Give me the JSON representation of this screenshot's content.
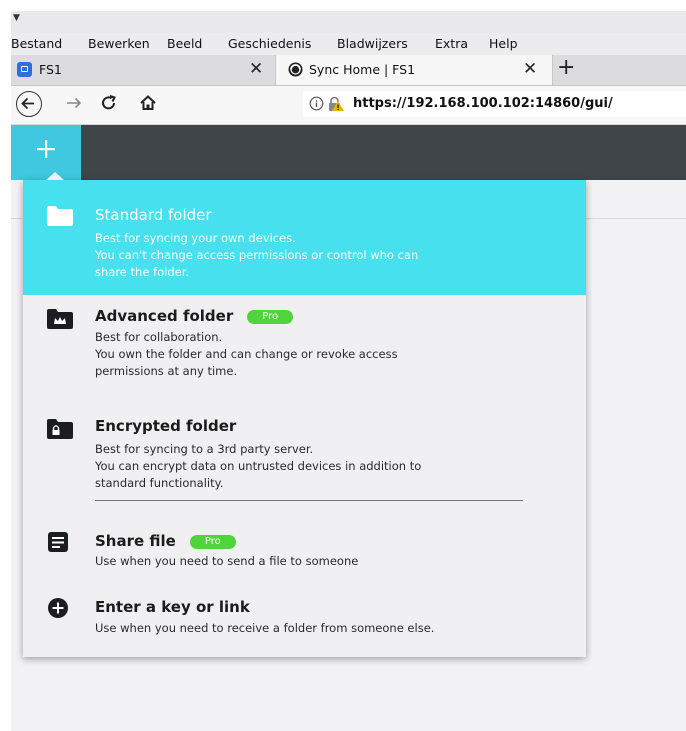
{
  "menubar": {
    "items": [
      "Bestand",
      "Bewerken",
      "Beeld",
      "Geschiedenis",
      "Bladwijzers",
      "Extra",
      "Help"
    ]
  },
  "tabs": [
    {
      "label": "FS1",
      "active": false
    },
    {
      "label": "Sync Home | FS1",
      "active": true
    }
  ],
  "navbar": {
    "url": "https://192.168.100.102:14860/gui/"
  },
  "colors": {
    "accent": "#47e0ee",
    "header": "#3f4448",
    "pro_badge": "#4fd43b"
  },
  "dropdown": {
    "items": [
      {
        "icon": "folder-icon",
        "title": "Standard folder",
        "desc": [
          "Best for syncing your own devices.",
          "You can't change access permissions or control who can",
          "share the folder."
        ],
        "highlighted": true
      },
      {
        "icon": "crown-folder-icon",
        "title": "Advanced folder",
        "badge": "Pro",
        "desc": [
          "Best for collaboration.",
          "You own the folder and can change or revoke access",
          "permissions at any time."
        ]
      },
      {
        "icon": "lock-folder-icon",
        "title": "Encrypted folder",
        "desc": [
          "Best for syncing to a 3rd party server.",
          "You can encrypt data on untrusted devices in addition to",
          "standard functionality."
        ]
      },
      {
        "icon": "file-icon",
        "title": "Share file",
        "badge": "Pro",
        "desc": [
          "Use when you need to send a file to someone"
        ]
      },
      {
        "icon": "plus-circle-icon",
        "title": "Enter a key or link",
        "desc": [
          "Use when you need to receive a folder from someone else."
        ]
      }
    ]
  }
}
